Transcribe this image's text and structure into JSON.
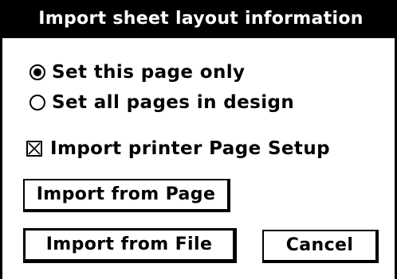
{
  "dialog": {
    "title": "Import sheet layout information",
    "options": [
      {
        "label": "Set this page only",
        "selected": true
      },
      {
        "label": "Set all pages in design",
        "selected": false
      }
    ],
    "checkbox": {
      "label": "Import printer Page Setup",
      "checked": true
    },
    "buttons": {
      "import_from_page": "Import from Page",
      "import_from_file": "Import from File",
      "cancel": "Cancel"
    }
  }
}
